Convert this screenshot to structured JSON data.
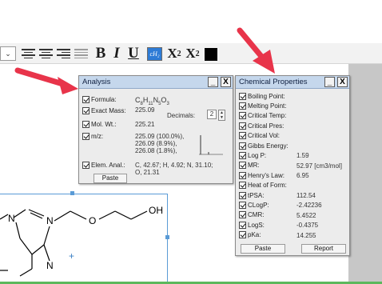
{
  "toolbar": {
    "combo_arrow": "⌄",
    "bold": "B",
    "italic": "I",
    "underline": "U",
    "chem_style": "cH₂",
    "subscript_base": "X",
    "subscript_mark": "2",
    "superscript_base": "X",
    "superscript_mark": "2",
    "color_swatch": "#000000"
  },
  "molecule": {
    "atoms": [
      "N",
      "N",
      "O",
      "OH",
      "N"
    ]
  },
  "analysis": {
    "title": "Analysis",
    "minimize": "_",
    "close": "X",
    "formula_label": "Formula:",
    "formula_parts": [
      "C",
      "8",
      "H",
      "11",
      "N",
      "5",
      "O",
      "3"
    ],
    "exact_mass_label": "Exact Mass:",
    "exact_mass_value": "225.09",
    "decimals_label": "Decimals:",
    "decimals_value": "2",
    "mol_wt_label": "Mol. Wt.:",
    "mol_wt_value": "225.21",
    "mz_label": "m/z:",
    "mz_values": [
      "225.09 (100.0%),",
      "226.09 (8.9%),",
      "226.08 (1.8%),"
    ],
    "elem_label": "Elem. Anal.:",
    "elem_lines": [
      "C, 42.67; H, 4.92; N, 31.10;",
      "O, 21.31"
    ],
    "paste": "Paste"
  },
  "chem": {
    "title": "Chemical Properties",
    "minimize": "_",
    "close": "X",
    "rows": [
      {
        "label": "Boiling Point:",
        "value": ""
      },
      {
        "label": "Melting Point:",
        "value": ""
      },
      {
        "label": "Critical Temp:",
        "value": ""
      },
      {
        "label": "Critical Pres:",
        "value": ""
      },
      {
        "label": "Critical Vol:",
        "value": ""
      },
      {
        "label": "Gibbs Energy:",
        "value": ""
      },
      {
        "label": "Log P:",
        "value": "1.59"
      },
      {
        "label": "MR:",
        "value": "52.97 [cm3/mol]"
      },
      {
        "label": "Henry's Law:",
        "value": "6.95"
      },
      {
        "label": "Heat of Form:",
        "value": ""
      },
      {
        "label": "tPSA:",
        "value": "112.54"
      },
      {
        "label": "CLogP:",
        "value": "-2.42236"
      },
      {
        "label": "CMR:",
        "value": "5.4522"
      },
      {
        "label": "LogS:",
        "value": "-0.4375"
      },
      {
        "label": "pKa:",
        "value": "14.255"
      }
    ],
    "paste": "Paste",
    "report": "Report"
  },
  "colors": {
    "arrow": "#e8344a",
    "title_bar": "#c5d7ec",
    "selection": "#5a9bd6",
    "bottom_line": "#5cb85c"
  }
}
